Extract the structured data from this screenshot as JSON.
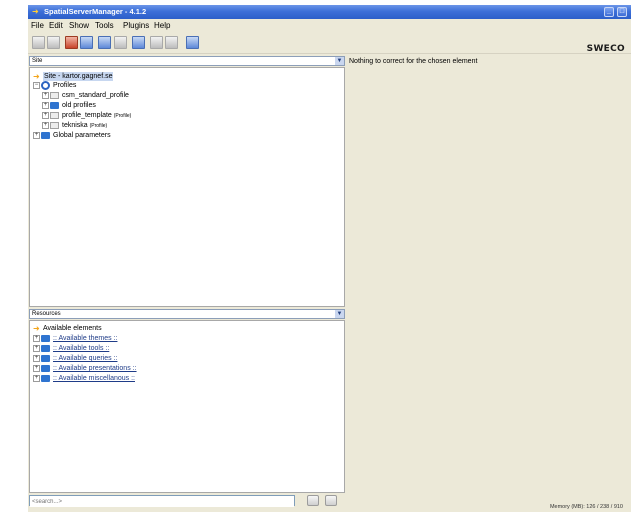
{
  "window": {
    "title": "SpatialServerManager - 4.1.2",
    "buttons": [
      "_",
      "□"
    ]
  },
  "menu": [
    "File",
    "Edit",
    "Show",
    "Tools",
    "Plugins",
    "Help"
  ],
  "logo": "SWECO",
  "site_panel": {
    "selector": "Site",
    "tree": {
      "root": "Site - kartor.gagnef.se",
      "profiles_node": "Profiles",
      "profiles": [
        {
          "name": "csm_standard_profile",
          "suffix": ""
        },
        {
          "name": "old profiles",
          "suffix": ""
        },
        {
          "name": "profile_template",
          "suffix": "(Profile)"
        },
        {
          "name": "tekniska",
          "suffix": "(Profile)"
        }
      ],
      "global": "Global parameters"
    }
  },
  "resources_panel": {
    "selector": "Resources",
    "root": "Available elements",
    "items": [
      ":: Available themes ::",
      ":: Available tools ::",
      ":: Available queries ::",
      ":: Available presentations ::",
      ":: Available miscellanous ::"
    ]
  },
  "search": {
    "placeholder": "<search...>"
  },
  "details": {
    "message": "Nothing to correct for the chosen element"
  },
  "status": {
    "memory": "Memory (MB): 126 / 238 / 910"
  }
}
